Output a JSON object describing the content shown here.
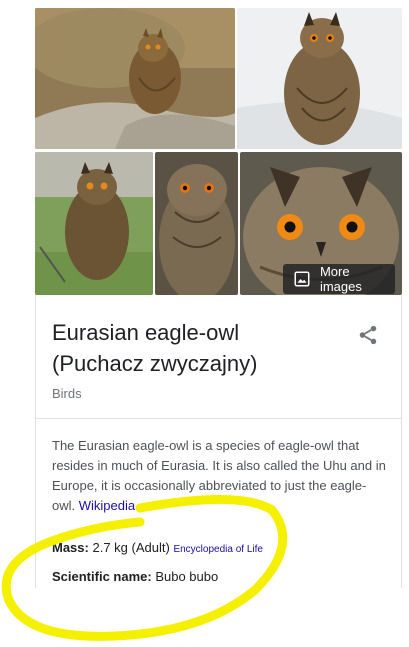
{
  "images": {
    "more_label": "More images"
  },
  "entity": {
    "title": "Eurasian eagle-owl (Puchacz zwyczajny)",
    "category": "Birds"
  },
  "description": {
    "text": "The Eurasian eagle-owl is a species of eagle-owl that resides in much of Eurasia. It is also called the Uhu and in Europe, it is occasionally abbreviated to just the eagle-owl.",
    "source": "Wikipedia"
  },
  "facts": {
    "mass": {
      "label": "Mass:",
      "value": "2.7 kg (Adult)",
      "source": "Encyclopedia of Life"
    },
    "scientific_name": {
      "label": "Scientific name:",
      "value": "Bubo bubo"
    }
  },
  "colors": {
    "highlight_marker": "#f5ef00",
    "link": "#1a0dab"
  },
  "icons": {
    "more_images": "image-icon",
    "share": "share-icon"
  }
}
